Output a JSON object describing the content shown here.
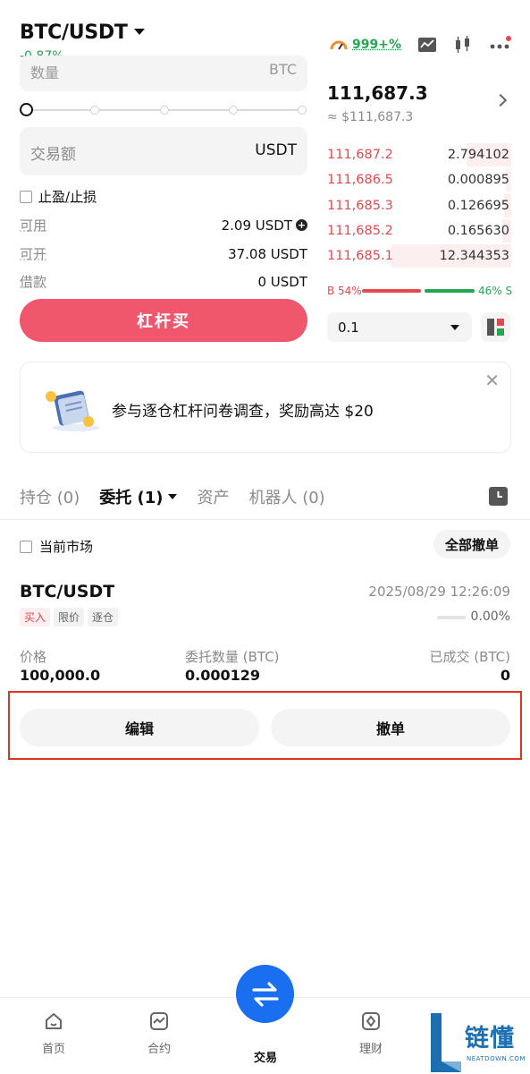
{
  "header": {
    "pair": "BTC/USDT",
    "change": "-0.87%",
    "gauge_value": "999+%"
  },
  "form": {
    "qty_label": "数量",
    "qty_unit": "BTC",
    "amount_label": "交易额",
    "amount_unit": "USDT",
    "tp_sl_label": "止盈/止损",
    "available_label": "可用",
    "available_value": "2.09 USDT",
    "openable_label": "可开",
    "openable_value": "37.08 USDT",
    "borrow_label": "借款",
    "borrow_value": "0 USDT",
    "buy_label": "杠杆买",
    "slider_value": 0
  },
  "orderbook": {
    "last_price": "111,687.3",
    "fiat_price": "≈ $111,687.3",
    "asks": [
      {
        "price": "111,687.2",
        "qty": "2.794102"
      },
      {
        "price": "111,686.5",
        "qty": "0.000895"
      },
      {
        "price": "111,685.3",
        "qty": "0.126695"
      },
      {
        "price": "111,685.2",
        "qty": "0.165630"
      },
      {
        "price": "111,685.1",
        "qty": "12.344353"
      }
    ],
    "buy_ratio": "B 54%",
    "sell_ratio": "46% S",
    "depth_value": "0.1"
  },
  "banner": {
    "text": "参与逐仓杠杆问卷调查，奖励高达 $20"
  },
  "tabs": {
    "positions": "持仓 (0)",
    "orders": "委托 (1)",
    "assets": "资产",
    "bots": "机器人 (0)"
  },
  "filters": {
    "current_market": "当前市场",
    "cancel_all": "全部撤单"
  },
  "order": {
    "pair": "BTC/USDT",
    "time": "2025/08/29 12:26:09",
    "tag_side": "买入",
    "tag_type": "限价",
    "tag_mode": "逐仓",
    "filled_pct": "0.00%",
    "price_label": "价格",
    "price_value": "100,000.0",
    "qty_label": "委托数量 (BTC)",
    "qty_value": "0.000129",
    "filled_label": "已成交 (BTC)",
    "filled_value": "0",
    "edit_label": "编辑",
    "cancel_label": "撤单"
  },
  "nav": {
    "home": "首页",
    "futures": "合约",
    "trade": "交易",
    "earn": "理财"
  },
  "watermark": {
    "brand": "链懂",
    "site": "NEATDOWN.COM"
  },
  "colors": {
    "buy_red": "#f0566c",
    "up_green": "#25a750",
    "brand_blue": "#1a6ef0",
    "highlight": "#e0341e"
  }
}
